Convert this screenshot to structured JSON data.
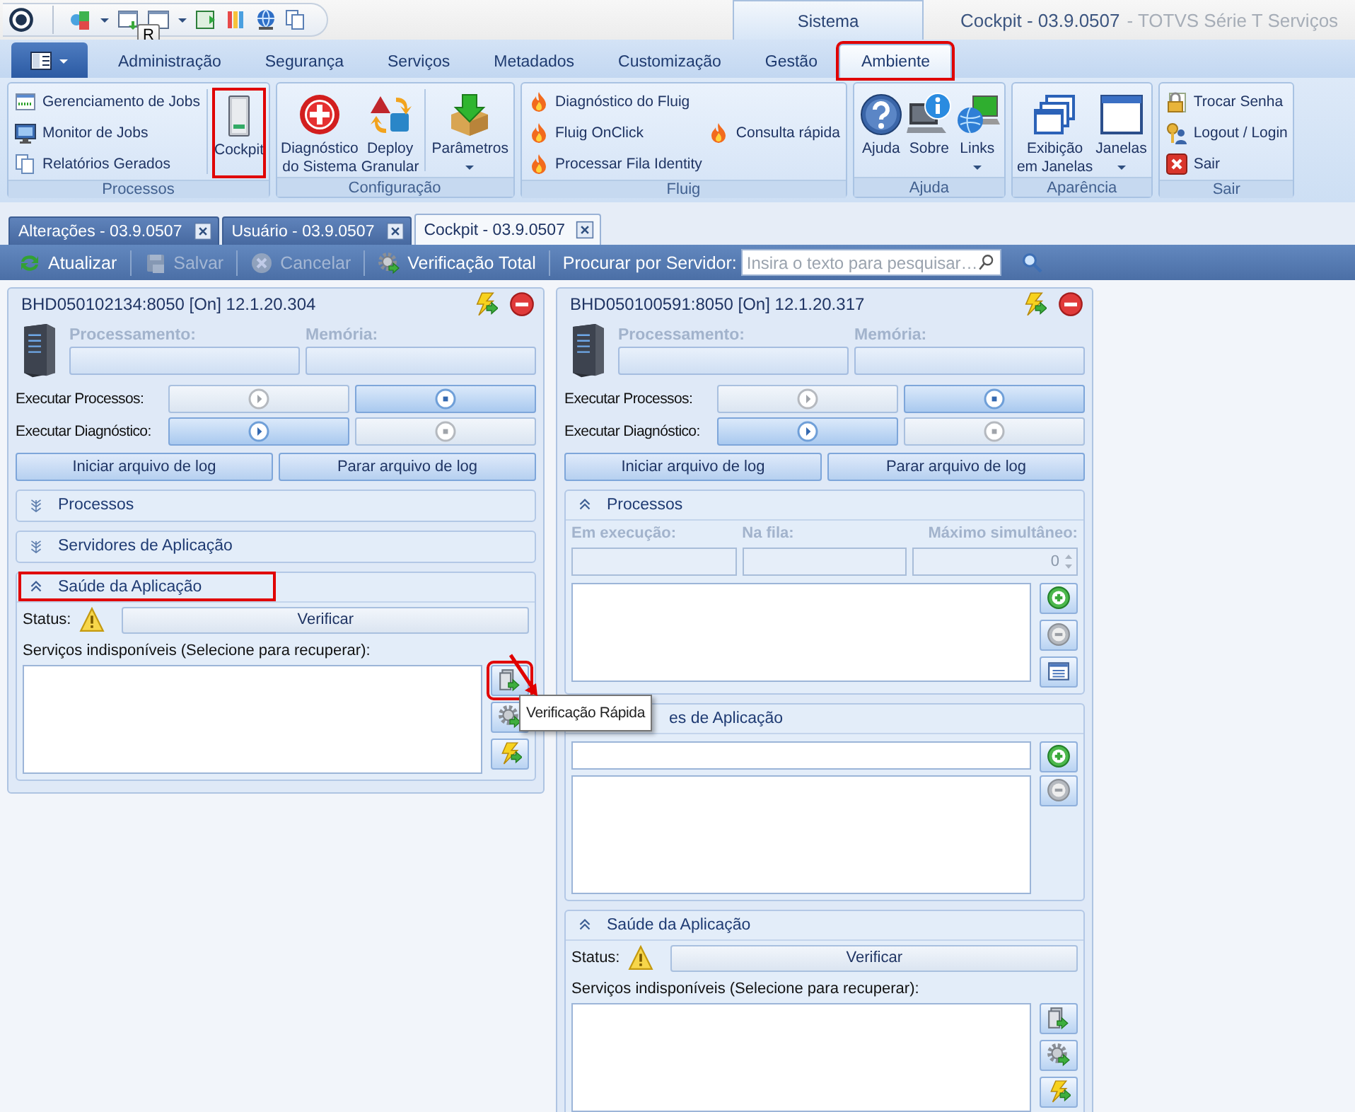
{
  "quick_access": {
    "keytip": "R"
  },
  "contextual_tab": {
    "label": "Sistema"
  },
  "window_title": {
    "title": "Cockpit - 03.9.0507",
    "subtitle": "- TOTVS Série T Serviços"
  },
  "ribbon_tabs": [
    {
      "label": "Administração",
      "selected": false,
      "highlighted": false
    },
    {
      "label": "Segurança",
      "selected": false,
      "highlighted": false
    },
    {
      "label": "Serviços",
      "selected": false,
      "highlighted": false
    },
    {
      "label": "Metadados",
      "selected": false,
      "highlighted": false
    },
    {
      "label": "Customização",
      "selected": false,
      "highlighted": false
    },
    {
      "label": "Gestão",
      "selected": false,
      "highlighted": false
    },
    {
      "label": "Ambiente",
      "selected": true,
      "highlighted": true
    }
  ],
  "ribbon_groups": [
    {
      "title": "Processos",
      "columns": [
        {
          "kind": "stack",
          "items": [
            {
              "kind": "small",
              "label": "Gerenciamento de Jobs",
              "highlighted": false
            },
            {
              "kind": "small",
              "label": "Monitor de Jobs",
              "highlighted": false
            },
            {
              "kind": "small",
              "label": "Relatórios Gerados",
              "highlighted": false
            }
          ]
        },
        {
          "kind": "separator"
        },
        {
          "kind": "stack",
          "items": [
            {
              "kind": "large",
              "label": "Cockpit",
              "highlighted": true
            }
          ]
        }
      ]
    },
    {
      "title": "Configuração",
      "columns": [
        {
          "kind": "stack",
          "items": [
            {
              "kind": "large",
              "label": "Diagnóstico\ndo Sistema",
              "highlighted": false
            }
          ]
        },
        {
          "kind": "stack",
          "items": [
            {
              "kind": "large",
              "label": "Deploy\nGranular",
              "highlighted": false
            }
          ]
        },
        {
          "kind": "separator"
        },
        {
          "kind": "stack",
          "items": [
            {
              "kind": "dropdown",
              "label": "Parâmetros",
              "highlighted": false
            }
          ]
        }
      ]
    },
    {
      "title": "Fluig",
      "columns": [
        {
          "kind": "stack",
          "items": [
            {
              "kind": "small",
              "label": "Diagnóstico do Fluig",
              "highlighted": false
            },
            {
              "kind": "small",
              "label": "Fluig OnClick",
              "highlighted": false
            },
            {
              "kind": "small",
              "label": "Processar Fila Identity",
              "highlighted": false
            }
          ]
        },
        {
          "kind": "stack",
          "items": [
            {
              "kind": "small",
              "label": "Consulta rápida",
              "highlighted": false
            }
          ]
        }
      ]
    },
    {
      "title": "Ajuda",
      "columns": [
        {
          "kind": "stack",
          "items": [
            {
              "kind": "large",
              "label": "Ajuda",
              "highlighted": false
            }
          ]
        },
        {
          "kind": "stack",
          "items": [
            {
              "kind": "large",
              "label": "Sobre",
              "highlighted": false
            }
          ]
        },
        {
          "kind": "stack",
          "items": [
            {
              "kind": "dropdown",
              "label": "Links",
              "highlighted": false
            }
          ]
        }
      ]
    },
    {
      "title": "Aparência",
      "columns": [
        {
          "kind": "stack",
          "items": [
            {
              "kind": "large",
              "label": "Exibição\nem Janelas",
              "highlighted": false
            }
          ]
        },
        {
          "kind": "stack",
          "items": [
            {
              "kind": "dropdown",
              "label": "Janelas",
              "highlighted": false
            }
          ]
        }
      ]
    },
    {
      "title": "Sair",
      "columns": [
        {
          "kind": "stack",
          "items": [
            {
              "kind": "small",
              "label": "Trocar Senha",
              "highlighted": false
            },
            {
              "kind": "small",
              "label": "Logout / Login",
              "highlighted": false
            },
            {
              "kind": "small",
              "label": "Sair",
              "highlighted": false
            }
          ]
        }
      ]
    }
  ],
  "doc_tabs": [
    {
      "label": "Alterações - 03.9.0507",
      "selected": false
    },
    {
      "label": "Usuário - 03.9.0507",
      "selected": false
    },
    {
      "label": "Cockpit - 03.9.0507",
      "selected": true
    }
  ],
  "toolbar": {
    "buttons": [
      {
        "label": "Atualizar",
        "disabled": false
      },
      {
        "label": "Salvar",
        "disabled": true
      },
      {
        "label": "Cancelar",
        "disabled": true
      },
      {
        "label": "Verificação Total",
        "disabled": false
      }
    ],
    "search_label": "Procurar por Servidor:",
    "placeholder": "Insira o texto para pesquisar…"
  },
  "servers": [
    {
      "title": "BHD050102134:8050 [On] 12.1.20.304",
      "cpu_label": "Processamento:",
      "memory_label": "Memória:",
      "run_processes_label": "Executar Processos:",
      "run_diagnostic_label": "Executar Diagnóstico:",
      "processes_running": true,
      "diagnostic_running": false,
      "start_log": "Iniciar arquivo de log",
      "stop_log": "Parar arquivo de log",
      "sections": [
        {
          "kind": "processes",
          "title": "Processos",
          "expanded": false,
          "highlighted": false
        },
        {
          "kind": "servers",
          "title": "Servidores de Aplicação",
          "expanded": false,
          "highlighted": false
        },
        {
          "kind": "health",
          "title": "Saúde da Aplicação",
          "expanded": true,
          "highlighted": true,
          "status_label": "Status:",
          "verify_button": "Verificar",
          "list_label": "Serviços indisponíveis (Selecione para recuperar):",
          "actions": [
            {
              "highlighted": true
            },
            {
              "highlighted": false
            },
            {
              "highlighted": false
            }
          ]
        }
      ]
    },
    {
      "title": "BHD050100591:8050 [On] 12.1.20.317",
      "cpu_label": "Processamento:",
      "memory_label": "Memória:",
      "run_processes_label": "Executar Processos:",
      "run_diagnostic_label": "Executar Diagnóstico:",
      "processes_running": true,
      "diagnostic_running": false,
      "start_log": "Iniciar arquivo de log",
      "stop_log": "Parar arquivo de log",
      "sections": [
        {
          "kind": "processes",
          "title": "Processos",
          "expanded": true,
          "highlighted": false,
          "running_label": "Em execução:",
          "queue_label": "Na fila:",
          "max_label": "Máximo simultâneo:",
          "max_value": "0"
        },
        {
          "kind": "servers",
          "title": "es de Aplicação",
          "expanded": true,
          "highlighted": false,
          "covered": true
        },
        {
          "kind": "health",
          "title": "Saúde da Aplicação",
          "expanded": true,
          "highlighted": false,
          "status_label": "Status:",
          "verify_button": "Verificar",
          "list_label": "Serviços indisponíveis (Selecione para recuperar):",
          "actions": [
            {
              "highlighted": false
            },
            {
              "highlighted": false
            },
            {
              "highlighted": false
            }
          ]
        }
      ]
    }
  ],
  "tooltip": {
    "text": "Verificação Rápida",
    "arrow": true
  }
}
